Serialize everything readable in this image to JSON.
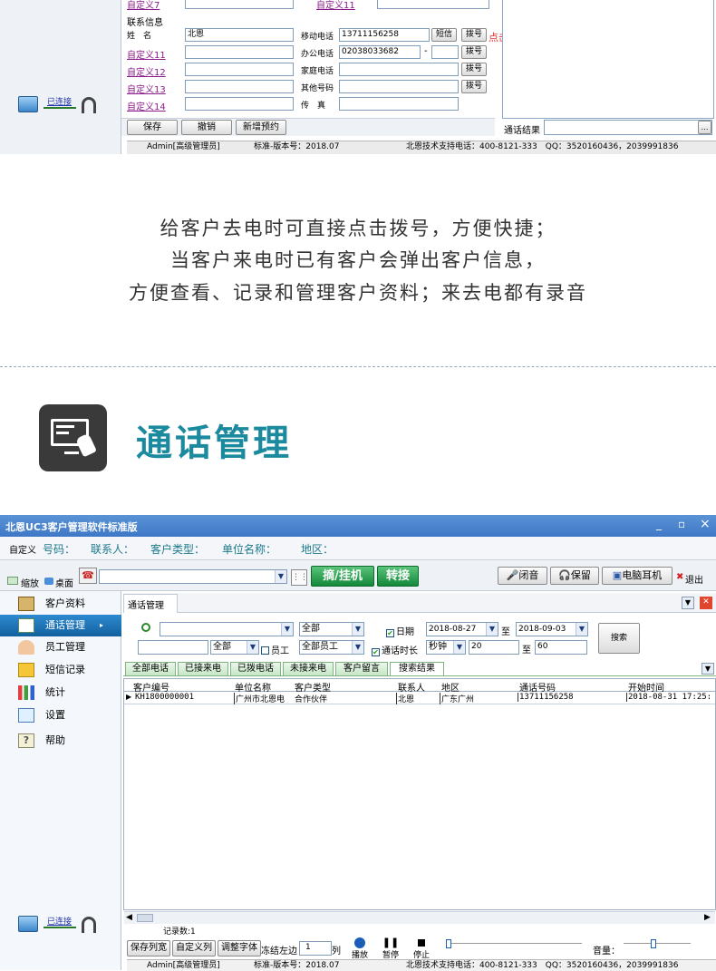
{
  "top_form": {
    "custom7": "自定义7",
    "custom11_top": "自定义11",
    "contact_info": "联系信息",
    "name_label": "姓　名",
    "name_value": "北恩",
    "mobile_label": "移动电话",
    "mobile_value": "13711156258",
    "sms_btn": "短信",
    "dial_btn": "拨号",
    "dial_hint": "点击拨号",
    "custom11": "自定义11",
    "office_label": "办公电话",
    "office_value": "02038033682",
    "office_sep": "-",
    "custom12": "自定义12",
    "home_label": "家庭电话",
    "custom13": "自定义13",
    "other_label": "其他号码",
    "custom14": "自定义14",
    "fax_label": "传　真",
    "save_btn": "保存",
    "cancel_btn": "撤销",
    "new_appt_btn": "新增预约",
    "call_result_label": "通话结果",
    "ellipsis": "…",
    "conn_label": "已连接"
  },
  "top_status": {
    "user": "Admin[高级管理员]",
    "version": "标准-版本号：2018.07",
    "support": "北恩技术支持电话：400-8121-333　QQ：3520160436，2039991836"
  },
  "captions": [
    "给客户去电时可直接点击拨号，方便快捷；",
    "当客户来电时已有客户会弹出客户信息，",
    "方便查看、记录和管理客户资料；来去电都有录音"
  ],
  "section_title": "通话管理",
  "app": {
    "title": "北恩UC3客户管理软件标准版",
    "win_min": "_",
    "win_max": "▫",
    "win_close": "×",
    "infobar": {
      "custom": "自定义",
      "number": "号码：",
      "contact": "联系人：",
      "ctype": "客户类型：",
      "unit": "单位名称：",
      "region": "地区："
    },
    "toolbar": {
      "shrink": "缩放",
      "desktop": "桌面",
      "pickup": "摘/挂机",
      "transfer": "转接",
      "mute": "闭音",
      "hold": "保留",
      "pc_headset": "电脑耳机",
      "exit": "退出"
    },
    "sidebar": [
      "客户资料",
      "通话管理",
      "员工管理",
      "短信记录",
      "统计",
      "设置",
      "帮助"
    ],
    "conn_label": "已连接",
    "doc_tab": "通话管理",
    "filters": {
      "all1": "全部",
      "date_label": "日期",
      "date_from": "2018-08-27",
      "to1": "至",
      "date_to": "2018-09-03",
      "search_btn": "搜索",
      "all2": "全部",
      "staff_label": "员工",
      "all_staff": "全部员工",
      "duration_label": "通话时长",
      "unit_sec": "秒钟",
      "dur_from": "20",
      "to2": "至",
      "dur_to": "60"
    },
    "subtabs": [
      "全部电话",
      "已接来电",
      "已拨电话",
      "未接来电",
      "客户留言",
      "搜索结果"
    ],
    "columns": [
      "客户编号",
      "单位名称",
      "客户类型",
      "联系人",
      "地区",
      "通话号码",
      "开始时间"
    ],
    "rows": [
      [
        "KH1800000001",
        "广州市北恩电",
        "合作伙伴",
        "北恩",
        "广东广州",
        "13711156258",
        "2018-08-31 17:25:"
      ]
    ],
    "record_count": "记录数:1",
    "bottom": {
      "save_col": "保存列宽",
      "custom_col": "自定义列",
      "adjust_font": "调整字体",
      "freeze_left": "冻结左边",
      "freeze_val": "1",
      "col_unit": "列",
      "play": "播放",
      "pause": "暂停",
      "stop": "停止",
      "volume": "音量："
    }
  },
  "bottom_status": {
    "user": "Admin[高级管理员]",
    "version": "标准-版本号：2018.07",
    "support": "北恩技术支持电话：400-8121-333　QQ：3520160436，2039991836"
  },
  "colors": {
    "teal": "#1c8a9e",
    "titlebar": "#3e78c6",
    "sidebar": "#f4f8fc",
    "selected": "#1a73b8",
    "dial_hint": "#e8322f"
  }
}
